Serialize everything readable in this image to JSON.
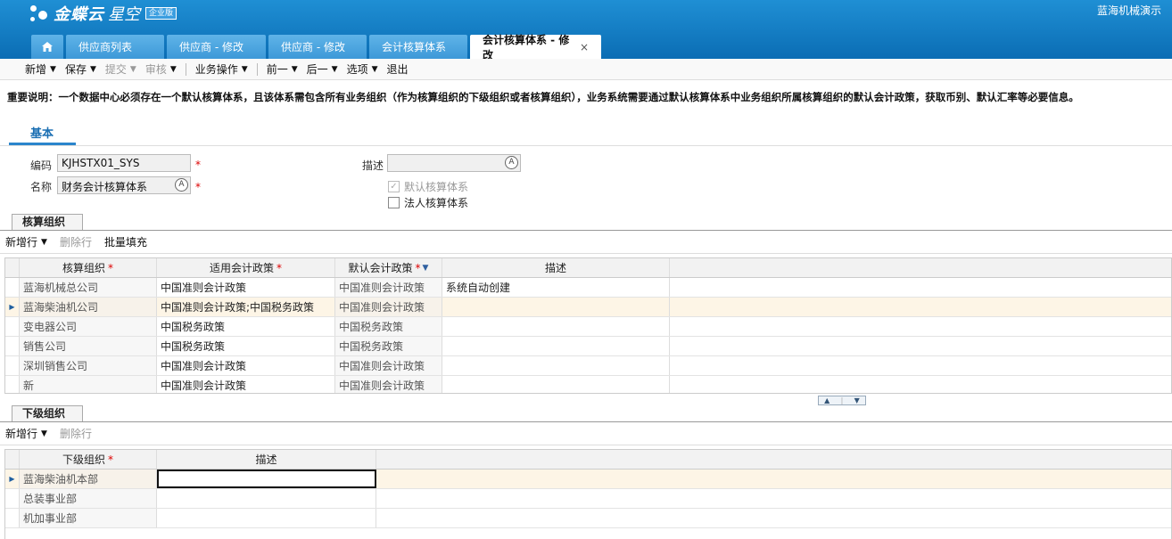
{
  "header": {
    "logo_text": "金蝶云",
    "logo_sub": "星空",
    "logo_badge": "企业版",
    "user": "蓝海机械演示"
  },
  "tabs": [
    {
      "label": "供应商列表"
    },
    {
      "label": "供应商 - 修改"
    },
    {
      "label": "供应商 - 修改"
    },
    {
      "label": "会计核算体系"
    },
    {
      "label": "会计核算体系 - 修改",
      "close": "×"
    }
  ],
  "toolbar": {
    "new": "新增",
    "save": "保存",
    "submit": "提交",
    "audit": "审核",
    "biz": "业务操作",
    "prev": "前一",
    "next": "后一",
    "options": "选项",
    "exit": "退出"
  },
  "notice": "重要说明：一个数据中心必须存在一个默认核算体系，且该体系需包含所有业务组织（作为核算组织的下级组织或者核算组织），业务系统需要通过默认核算体系中业务组织所属核算组织的默认会计政策，获取币别、默认汇率等必要信息。",
  "section": {
    "title": "基本"
  },
  "form": {
    "code_label": "编码",
    "code_value": "KJHSTX01_SYS",
    "name_label": "名称",
    "name_value": "财务会计核算体系",
    "desc_label": "描述",
    "desc_value": "",
    "default_label": "默认核算体系",
    "legal_label": "法人核算体系",
    "required_mark": "*"
  },
  "accounting_org": {
    "group_title": "核算组织",
    "actions": {
      "add": "新增行",
      "delete": "删除行",
      "batch": "批量填充"
    },
    "columns": [
      "核算组织",
      "适用会计政策",
      "默认会计政策",
      "描述"
    ],
    "rows": [
      {
        "org": "蓝海机械总公司",
        "policy": "中国准则会计政策",
        "default": "中国准则会计政策",
        "desc": "系统自动创建"
      },
      {
        "org": "蓝海柴油机公司",
        "policy": "中国准则会计政策;中国税务政策",
        "default": "中国准则会计政策",
        "desc": ""
      },
      {
        "org": "变电器公司",
        "policy": "中国税务政策",
        "default": "中国税务政策",
        "desc": ""
      },
      {
        "org": "销售公司",
        "policy": "中国税务政策",
        "default": "中国税务政策",
        "desc": ""
      },
      {
        "org": "深圳销售公司",
        "policy": "中国准则会计政策",
        "default": "中国准则会计政策",
        "desc": ""
      },
      {
        "org": "新",
        "policy": "中国准则会计政策",
        "default": "中国准则会计政策",
        "desc": ""
      }
    ]
  },
  "sub_org": {
    "group_title": "下级组织",
    "actions": {
      "add": "新增行",
      "delete": "删除行"
    },
    "columns": [
      "下级组织",
      "描述"
    ],
    "rows": [
      {
        "org": "蓝海柴油机本部",
        "desc": ""
      },
      {
        "org": "总装事业部",
        "desc": ""
      },
      {
        "org": "机加事业部",
        "desc": ""
      }
    ]
  }
}
